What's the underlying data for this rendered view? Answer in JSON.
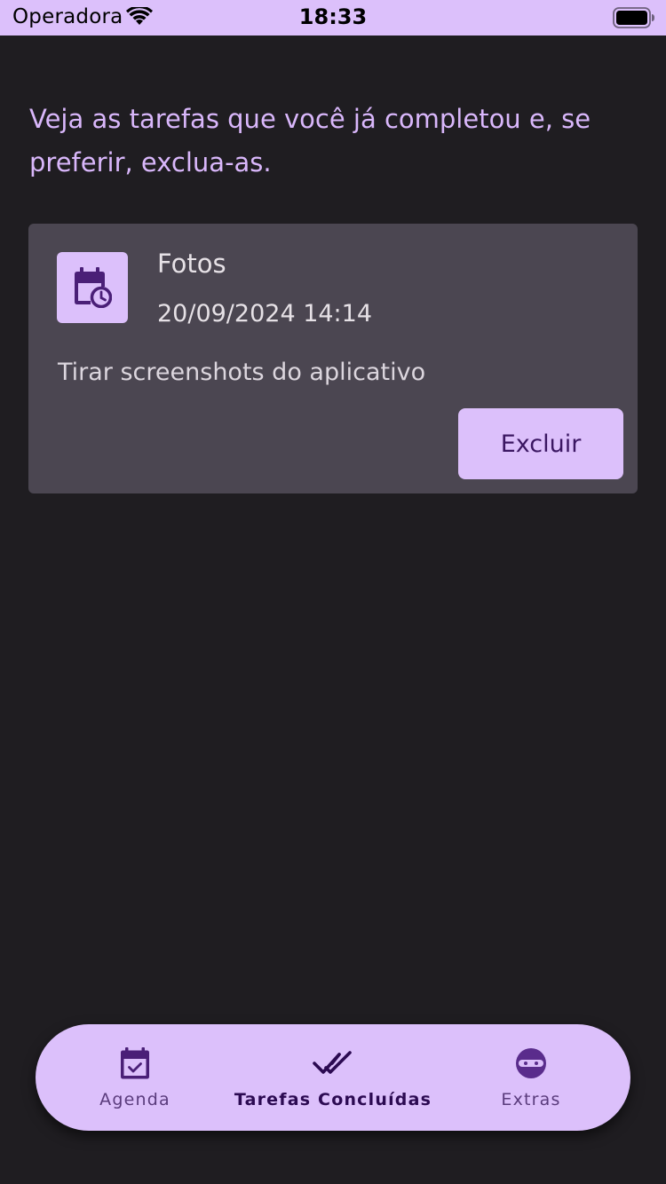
{
  "status_bar": {
    "carrier": "Operadora",
    "time": "18:33"
  },
  "intro_text": "Veja as tarefas que você já completou e, se preferir, exclua-as.",
  "tasks": [
    {
      "icon": "calendar-clock-icon",
      "title": "Fotos",
      "datetime": "20/09/2024 14:14",
      "description": "Tirar screenshots do aplicativo",
      "delete_label": "Excluir"
    }
  ],
  "bottom_nav": {
    "items": [
      {
        "label": "Agenda",
        "icon": "calendar-check-icon",
        "active": false
      },
      {
        "label": "Tarefas Concluídas",
        "icon": "double-check-icon",
        "active": true
      },
      {
        "label": "Extras",
        "icon": "ninja-icon",
        "active": false
      }
    ]
  },
  "colors": {
    "background": "#1f1d21",
    "accent": "#dcc0fb",
    "card": "#4b4651",
    "accent_text": "#d9b7fb",
    "on_accent": "#3b1762"
  }
}
